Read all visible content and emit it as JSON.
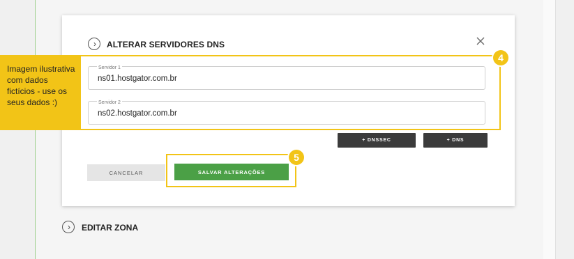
{
  "dialog": {
    "title": "ALTERAR SERVIDORES DNS",
    "fields": [
      {
        "label": "Servidor 1",
        "value": "ns01.hostgator.com.br"
      },
      {
        "label": "Servidor 2",
        "value": "ns02.hostgator.com.br"
      }
    ],
    "dnssec_label": "+ DNSSEC",
    "dns_label": "+ DNS",
    "cancel_label": "CANCELAR",
    "save_label": "SALVAR ALTERAÇÕES"
  },
  "annotations": {
    "callout_text": "Imagem ilustrativa com dados fictícios - use os seus dados :)",
    "badge_fields": "4",
    "badge_save": "5",
    "highlight_color": "#f2c417"
  },
  "zone": {
    "title": "EDITAR ZONA"
  },
  "colors": {
    "save_green": "#4ba046",
    "dark_button": "#3b3b3b"
  }
}
